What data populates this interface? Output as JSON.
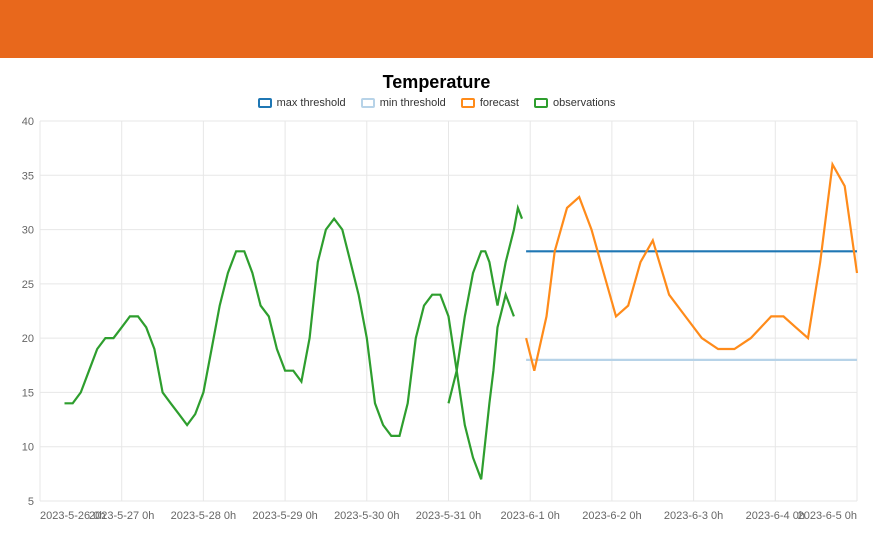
{
  "header": {
    "color": "#e8681c"
  },
  "chart_data": {
    "type": "line",
    "title": "Temperature",
    "xlabel": "",
    "ylabel": "",
    "ylim": [
      5,
      40
    ],
    "x_ticks": [
      "2023-5-26 0h",
      "2023-5-27 0h",
      "2023-5-28 0h",
      "2023-5-29 0h",
      "2023-5-30 0h",
      "2023-5-31 0h",
      "2023-6-1 0h",
      "2023-6-2 0h",
      "2023-6-3 0h",
      "2023-6-4 0h",
      "2023-6-5 0h"
    ],
    "y_ticks": [
      5,
      10,
      15,
      20,
      25,
      30,
      35,
      40
    ],
    "legend": [
      "max threshold",
      "min threshold",
      "forecast",
      "observations"
    ],
    "colors": {
      "max threshold": "#1f77b4",
      "min threshold": "#b7d3e8",
      "forecast": "#ff8b1a",
      "observations": "#2e9e2e"
    },
    "series": [
      {
        "name": "max threshold",
        "x": [
          5.95,
          10.0
        ],
        "values": [
          28,
          28
        ]
      },
      {
        "name": "min threshold",
        "x": [
          5.95,
          10.0
        ],
        "values": [
          18,
          18
        ]
      },
      {
        "name": "forecast",
        "x": [
          5.95,
          6.05,
          6.2,
          6.3,
          6.45,
          6.6,
          6.75,
          6.9,
          7.05,
          7.2,
          7.35,
          7.5,
          7.7,
          7.9,
          8.1,
          8.3,
          8.5,
          8.7,
          8.95,
          9.1,
          9.25,
          9.4,
          9.55,
          9.7,
          9.85,
          10.0
        ],
        "values": [
          20,
          17,
          22,
          28,
          32,
          33,
          30,
          26,
          22,
          23,
          27,
          29,
          24,
          22,
          20,
          19,
          19,
          20,
          22,
          22,
          21,
          20,
          27,
          36,
          34,
          26
        ]
      },
      {
        "name": "observations",
        "x": [
          0.3,
          0.4,
          0.5,
          0.6,
          0.7,
          0.8,
          0.9,
          1.0,
          1.1,
          1.2,
          1.3,
          1.4,
          1.5,
          1.6,
          1.7,
          1.8,
          1.9,
          2.0,
          2.1,
          2.2,
          2.3,
          2.4,
          2.5,
          2.6,
          2.7,
          2.8,
          2.9,
          3.0,
          3.1,
          3.2,
          3.3,
          3.4,
          3.5,
          3.6,
          3.7,
          3.8,
          3.9,
          4.0,
          4.1,
          4.2,
          4.3,
          4.4,
          4.5,
          4.6,
          4.7,
          4.8,
          4.9,
          5.0,
          5.1,
          5.2,
          5.3,
          5.4,
          5.5,
          5.55,
          5.6,
          5.7,
          5.8
        ],
        "values": [
          14,
          14,
          15,
          17,
          19,
          20,
          20,
          21,
          22,
          22,
          21,
          19,
          15,
          14,
          13,
          12,
          13,
          15,
          19,
          23,
          26,
          28,
          28,
          26,
          23,
          22,
          19,
          17,
          17,
          16,
          20,
          27,
          30,
          31,
          30,
          27,
          24,
          20,
          14,
          12,
          11,
          11,
          14,
          20,
          23,
          24,
          24,
          22,
          17,
          12,
          9,
          7,
          14,
          17,
          21,
          24,
          22
        ],
        "extra_x": [
          5.0,
          5.1,
          5.2,
          5.3,
          5.4,
          5.45,
          5.5,
          5.55,
          5.6,
          5.7,
          5.8,
          5.85,
          5.9
        ],
        "extra_values": [
          14,
          17,
          22,
          26,
          28,
          28,
          27,
          25,
          23,
          27,
          30,
          32,
          31
        ]
      }
    ]
  }
}
